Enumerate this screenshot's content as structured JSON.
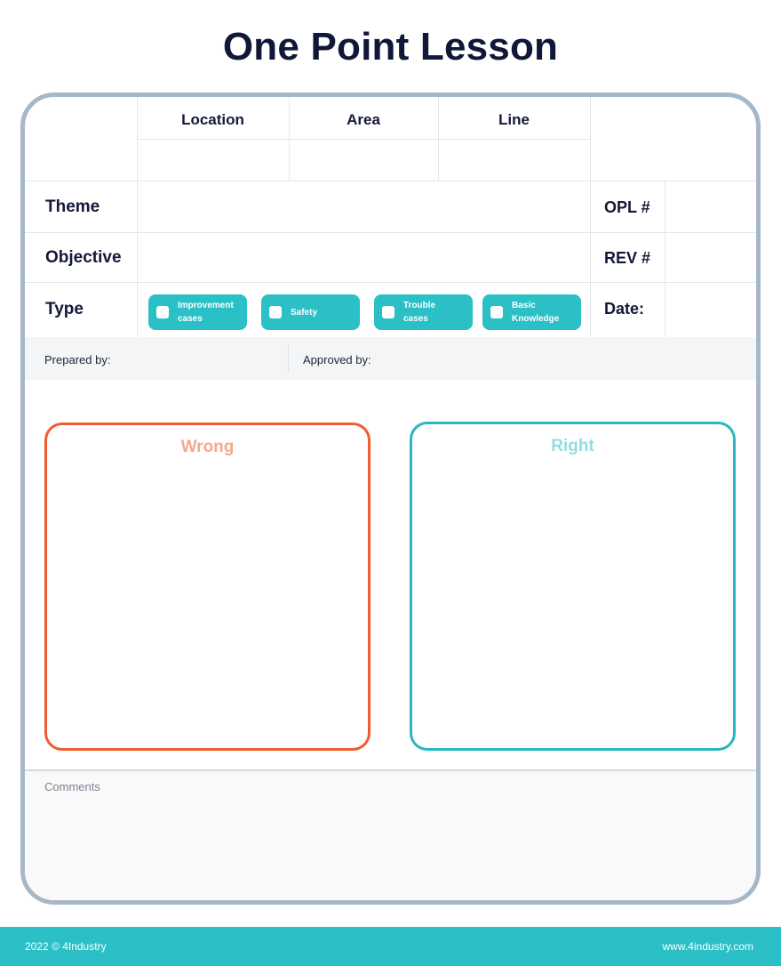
{
  "title": "One Point Lesson",
  "header": {
    "location": "Location",
    "area": "Area",
    "line": "Line"
  },
  "rows": {
    "theme": "Theme",
    "objective": "Objective",
    "type": "Type"
  },
  "right_labels": {
    "opl": "OPL #",
    "rev": "REV #",
    "date": "Date:"
  },
  "type_options": [
    {
      "line1": "Improvement",
      "line2": "cases"
    },
    {
      "line1": "Safety",
      "line2": ""
    },
    {
      "line1": "Trouble",
      "line2": "cases"
    },
    {
      "line1": "Basic",
      "line2": "Knowledge"
    }
  ],
  "prepared_by": "Prepared by:",
  "approved_by": "Approved by:",
  "wrong": "Wrong",
  "right": "Right",
  "comments": "Comments",
  "colors": {
    "accent": "#2bbfc6",
    "wrong": "#ee5d2d",
    "wrong_title": "#f5a98c",
    "right": "#2bb7c0",
    "right_title": "#93dde1",
    "border": "#a6b8c7"
  },
  "footer": {
    "copyright": "2022 © 4Industry",
    "website": "www.4industry.com"
  }
}
